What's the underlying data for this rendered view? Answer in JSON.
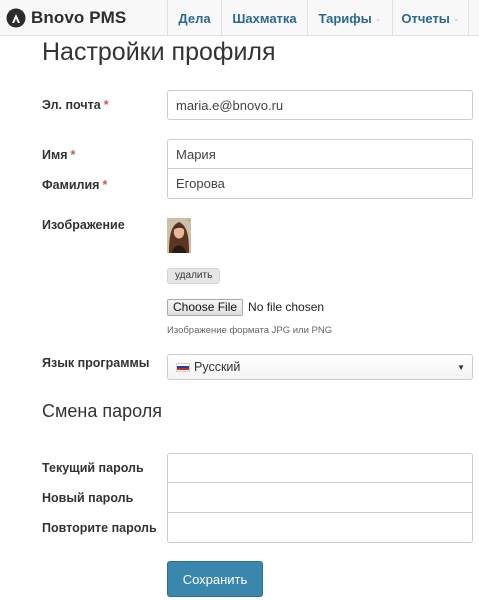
{
  "navbar": {
    "brand": "Bnovo PMS",
    "items": [
      {
        "label": "Дела",
        "has_dropdown": false
      },
      {
        "label": "Шахматка",
        "has_dropdown": false
      },
      {
        "label": "Тарифы",
        "has_dropdown": true
      },
      {
        "label": "Отчеты",
        "has_dropdown": true
      }
    ]
  },
  "page": {
    "title": "Настройки профиля"
  },
  "form": {
    "email": {
      "label": "Эл. почта",
      "required": "*",
      "value": "maria.e@bnovo.ru"
    },
    "first_name": {
      "label": "Имя",
      "required": "*",
      "value": "Мария"
    },
    "last_name": {
      "label": "Фамилия",
      "required": "*",
      "value": "Егорова"
    },
    "image": {
      "label": "Изображение",
      "delete_label": "удалить",
      "choose_file_label": "Choose File",
      "no_file_text": "No file chosen",
      "help_text": "Изображение формата JPG или PNG"
    },
    "language": {
      "label": "Язык программы",
      "value": "Русский",
      "flag_colors": [
        "#ffffff",
        "#1c3fa8",
        "#d52b1e"
      ]
    }
  },
  "password_section": {
    "title": "Смена пароля",
    "current": {
      "label": "Текущий пароль",
      "value": ""
    },
    "new": {
      "label": "Новый пароль",
      "value": ""
    },
    "repeat": {
      "label": "Повторите пароль",
      "value": ""
    }
  },
  "actions": {
    "save_label": "Сохранить"
  },
  "colors": {
    "accent": "#3a87ad",
    "nav_link": "#2a6a8e",
    "required": "#d9534f"
  }
}
